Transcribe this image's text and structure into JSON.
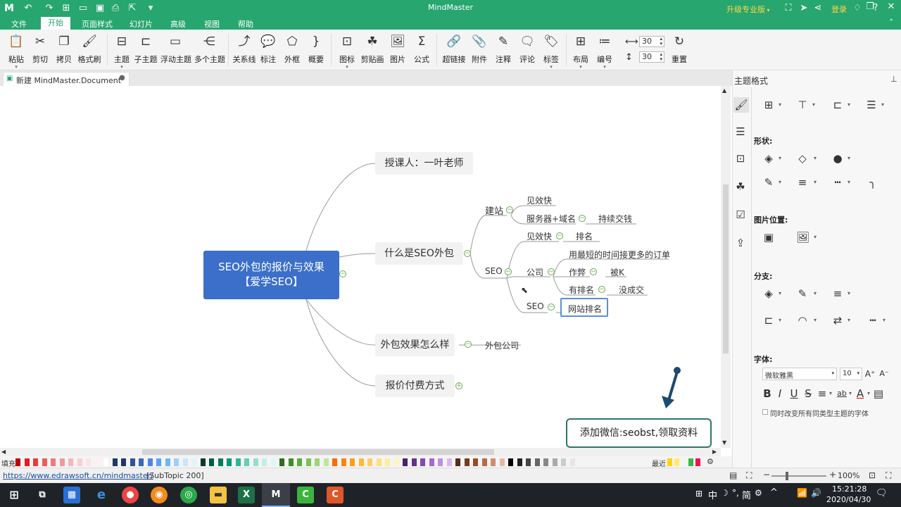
{
  "app": {
    "title": "MindMaster"
  },
  "titlebar": {
    "upgrade": "升级专业版",
    "login": "登录"
  },
  "menu": {
    "items": [
      "文件",
      "开始",
      "页面样式",
      "幻灯片",
      "高级",
      "视图",
      "帮助"
    ]
  },
  "ribbon": {
    "buttons": [
      "粘贴",
      "剪切",
      "拷贝",
      "格式刷",
      "主题",
      "子主题",
      "浮动主题",
      "多个主题",
      "关系线",
      "标注",
      "外框",
      "概要",
      "图标",
      "剪贴画",
      "图片",
      "公式",
      "超链接",
      "附件",
      "注释",
      "评论",
      "标签",
      "布局",
      "编号",
      "重置"
    ],
    "spacing_h": "30",
    "spacing_v": "30"
  },
  "doc_tab": {
    "name": "新建 MindMaster.Document"
  },
  "mindmap": {
    "central": {
      "line1": "SEO外包的报价与效果",
      "line2": "【爱学SEO】"
    },
    "topics": [
      "授课人：一叶老师",
      "什么是SEO外包",
      "外包效果怎么样",
      "报价付费方式"
    ],
    "sub": {
      "jianzhan": "建站",
      "jianxiaokuai1": "见效快",
      "fuwuqi": "服务器+域名",
      "chixu": "持续交钱",
      "seo1": "SEO",
      "jianxiaokuai2": "见效快",
      "paiming": "排名",
      "gongsi": "公司",
      "zuiduan": "用最短的时间接更多的订单",
      "zuobi": "作弊",
      "beik": "被K",
      "youpaiming": "有排名",
      "meichengjiao": "没成交",
      "seo2": "SEO",
      "wangzhan": "网站排名",
      "waibao": "外包公司"
    }
  },
  "callout": {
    "text": "添加微信:seobst,领取资料"
  },
  "colorbar": {
    "fill_label": "填充",
    "recent_label": "最近"
  },
  "panel": {
    "title": "主题格式",
    "shape_label": "形状:",
    "image_pos_label": "图片位置:",
    "branch_label": "分支:",
    "font_label": "字体:",
    "font_name": "微软雅黑",
    "font_size": "10",
    "checkbox_text": "同时改变所有同类型主题的字体"
  },
  "status": {
    "link": "https://www.edrawsoft.cn/mindmaster/",
    "info": "[SubTopic 200]",
    "zoom": "100%"
  },
  "taskbar": {
    "ime": "中",
    "ime2": "简",
    "time": "15:21:28",
    "date": "2020/04/30"
  },
  "colors": {
    "brand": "#27a66f",
    "central": "#3b6fc9",
    "accent_btn": "#ffd54a"
  }
}
